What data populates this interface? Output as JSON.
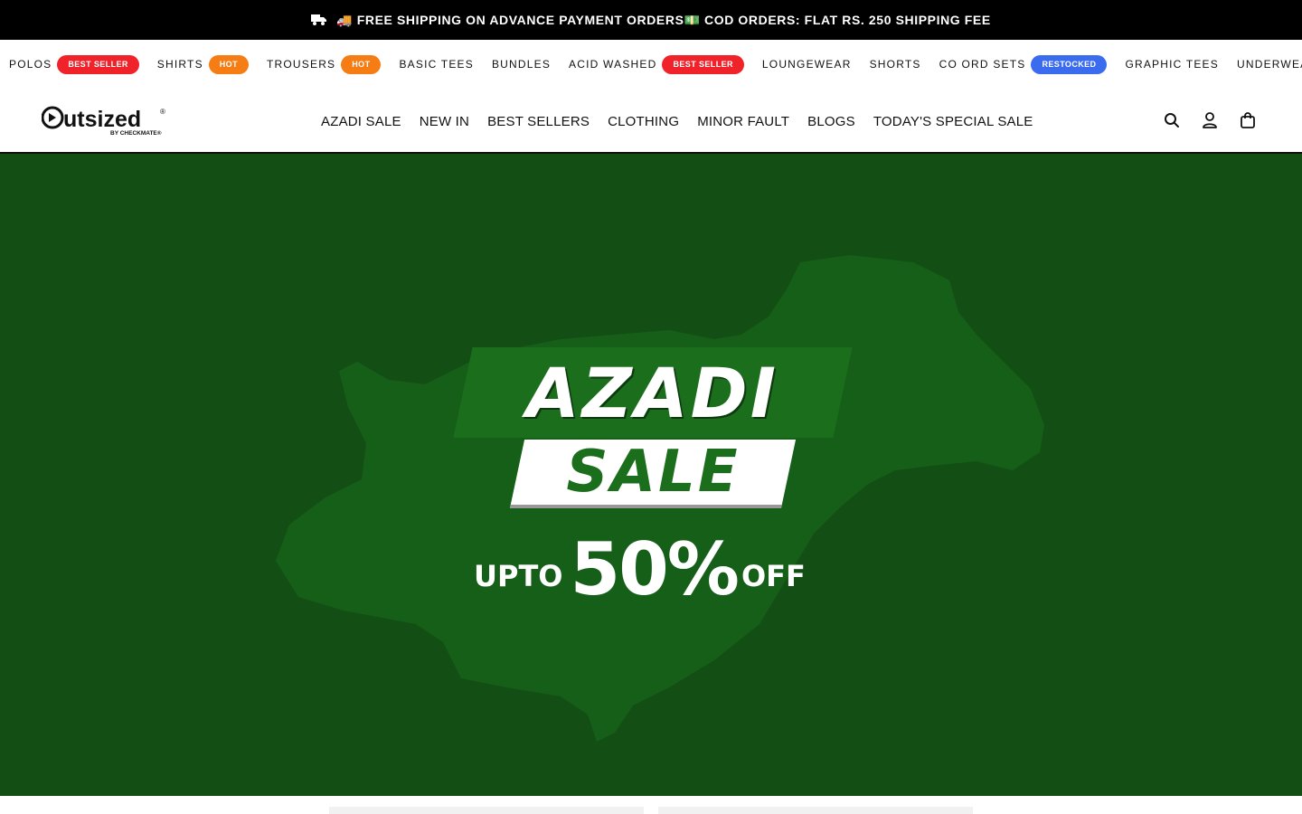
{
  "announcement": {
    "icon": "truck-icon",
    "text": "🚚 FREE SHIPPING ON ADVANCE PAYMENT ORDERS💵 COD ORDERS: FLAT RS. 250 SHIPPING FEE"
  },
  "categories": [
    {
      "label": "POLOS",
      "badge": "BEST SELLER",
      "badge_color": "#f0232b"
    },
    {
      "label": "SHIRTS",
      "badge": "HOT",
      "badge_color": "#f57d14"
    },
    {
      "label": "TROUSERS",
      "badge": "HOT",
      "badge_color": "#f57d14"
    },
    {
      "label": "BASIC TEES"
    },
    {
      "label": "BUNDLES"
    },
    {
      "label": "ACID WASHED",
      "badge": "BEST SELLER",
      "badge_color": "#f0232b"
    },
    {
      "label": "LOUNGEWEAR"
    },
    {
      "label": "SHORTS"
    },
    {
      "label": "CO ORD SETS",
      "badge": "RESTOCKED",
      "badge_color": "#3b6cf0"
    },
    {
      "label": "GRAPHIC TEES"
    },
    {
      "label": "UNDERWEARS"
    }
  ],
  "header": {
    "logo_text": "utsized",
    "logo_registered": "®",
    "logo_sub": "BY CHECKMATE®",
    "nav": [
      "AZADI SALE",
      "NEW IN",
      "BEST SELLERS",
      "CLOTHING",
      "MINOR FAULT",
      "BLOGS",
      "TODAY'S SPECIAL SALE"
    ],
    "icons": [
      "search-icon",
      "account-icon",
      "cart-icon"
    ]
  },
  "hero": {
    "background": "#134f14",
    "title_line1": "AZADI",
    "title_line2": "SALE",
    "offer_prefix": "UPTO",
    "offer_value": "50%",
    "offer_suffix": "OFF"
  }
}
